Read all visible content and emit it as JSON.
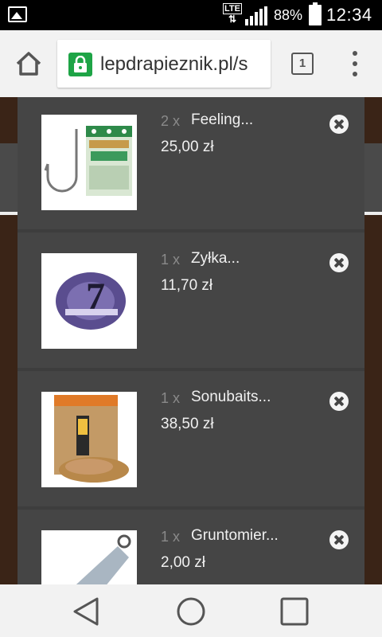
{
  "status_bar": {
    "network": "LTE",
    "battery_percent": "88%",
    "time": "12:34"
  },
  "browser": {
    "url": "lepdrapieznik.pl/s",
    "tab_count": "1"
  },
  "cart": {
    "items": [
      {
        "qty": "2 x",
        "name": "Feeling...",
        "price": "25,00 zł"
      },
      {
        "qty": "1 x",
        "name": "Zyłka...",
        "price": "11,70 zł"
      },
      {
        "qty": "1 x",
        "name": "Sonubaits...",
        "price": "38,50 zł"
      },
      {
        "qty": "1 x",
        "name": "Gruntomier...",
        "price": "2,00 zł"
      }
    ]
  },
  "colors": {
    "panel": "#454545",
    "lock_green": "#1ea446"
  }
}
